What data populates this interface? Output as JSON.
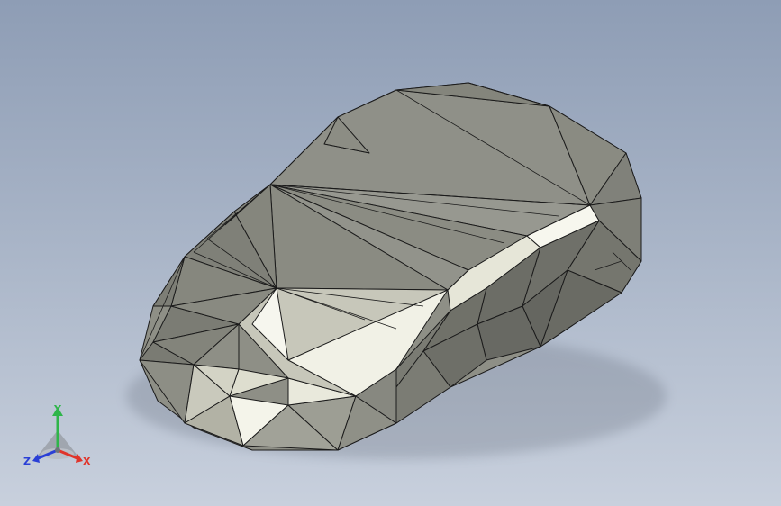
{
  "viewport": {
    "background_top": "#8e9db5",
    "background_bottom": "#c8d0dd",
    "model": {
      "kind": "faceted-solid-mesh",
      "shade_color": "#8c8d84",
      "highlight_color": "#f4f4ea",
      "edge_color": "#1b1b1b"
    }
  },
  "triad": {
    "x_label": "X",
    "y_label": "Y",
    "z_label": "Z",
    "x_color": "#e0342a",
    "y_color": "#2fb54a",
    "z_color": "#2a3fd6"
  }
}
